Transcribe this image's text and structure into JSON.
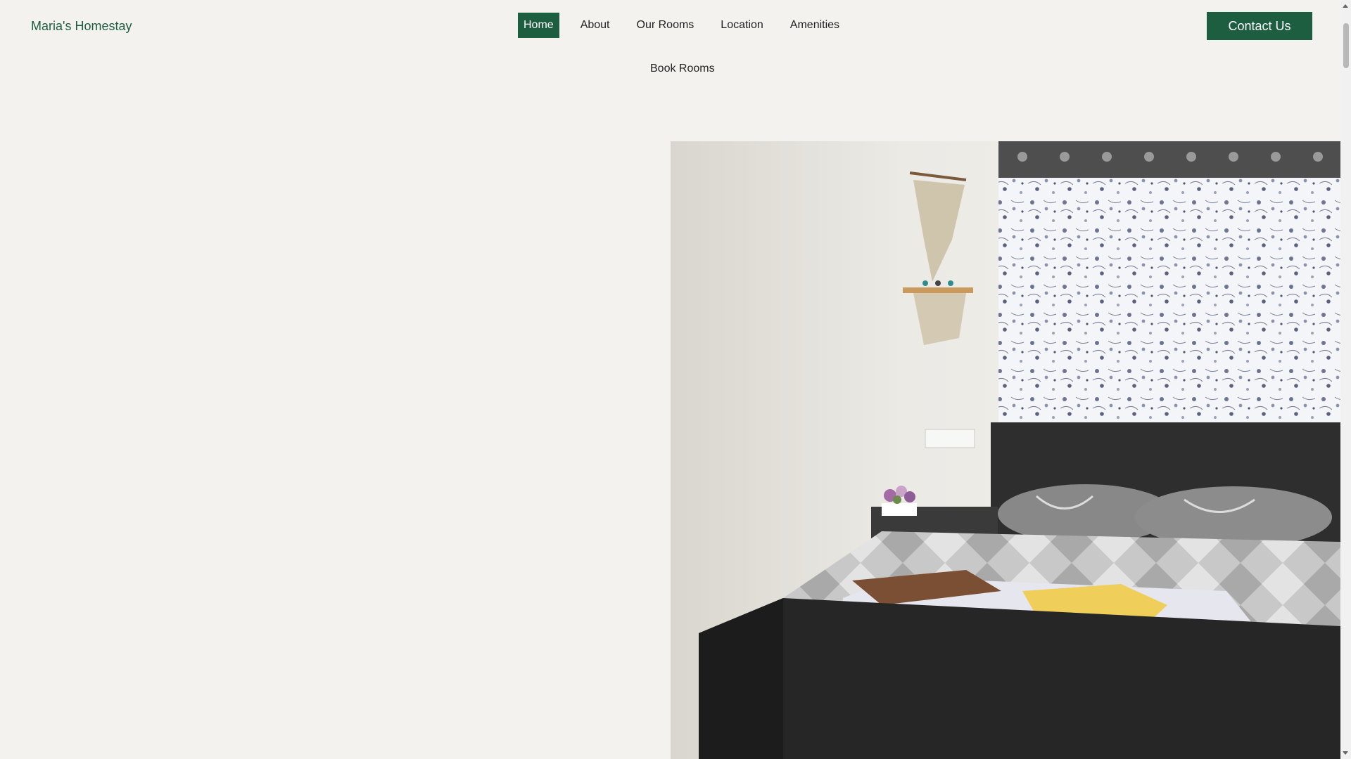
{
  "brand": {
    "name": "Maria's Homestay"
  },
  "nav": {
    "items": [
      {
        "label": "Home",
        "active": true
      },
      {
        "label": "About"
      },
      {
        "label": "Our Rooms"
      },
      {
        "label": "Location"
      },
      {
        "label": "Amenities"
      }
    ],
    "second_row": {
      "label": "Book Rooms"
    }
  },
  "header": {
    "contact_label": "Contact Us"
  },
  "colors": {
    "accent": "#1e5e40",
    "background": "#f3f2ee"
  }
}
